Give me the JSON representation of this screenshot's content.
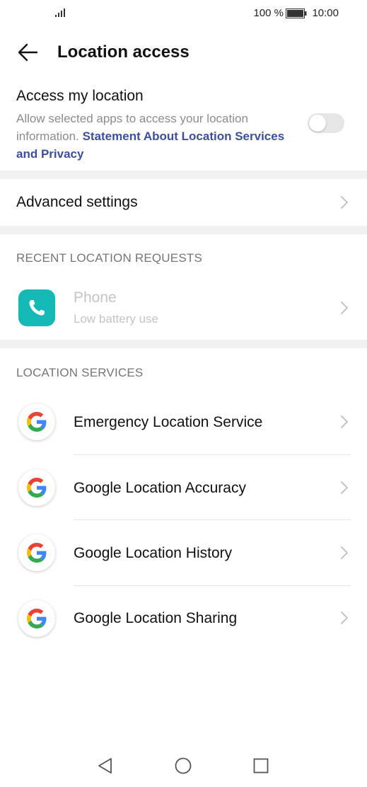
{
  "status_bar": {
    "battery_percent": "100 %",
    "time": "10:00",
    "icons": [
      "signal-icon",
      "battery-icon"
    ]
  },
  "header": {
    "title": "Location access",
    "back_icon": "back-arrow-icon"
  },
  "access": {
    "title": "Access my location",
    "description": "Allow selected apps to access your location information.",
    "link": "Statement About Location Services and Privacy",
    "toggle_on": false
  },
  "advanced": {
    "label": "Advanced settings"
  },
  "recent": {
    "section_label": "RECENT LOCATION REQUESTS",
    "items": [
      {
        "name": "Phone",
        "subtitle": "Low battery use",
        "icon": "phone-app-icon"
      }
    ]
  },
  "services": {
    "section_label": "LOCATION SERVICES",
    "items": [
      {
        "label": "Emergency Location Service",
        "icon": "google-icon"
      },
      {
        "label": "Google Location Accuracy",
        "icon": "google-icon"
      },
      {
        "label": "Google Location History",
        "icon": "google-icon"
      },
      {
        "label": "Google Location Sharing",
        "icon": "google-icon"
      }
    ]
  },
  "nav_bar": {
    "icons": [
      "nav-back-icon",
      "nav-home-icon",
      "nav-recents-icon"
    ]
  },
  "colors": {
    "link": "#3d4f9b",
    "phone_app": "#14b8b5",
    "divider": "#f1f1f1",
    "secondary_text": "#8c8c8c",
    "section_label": "#757575"
  }
}
